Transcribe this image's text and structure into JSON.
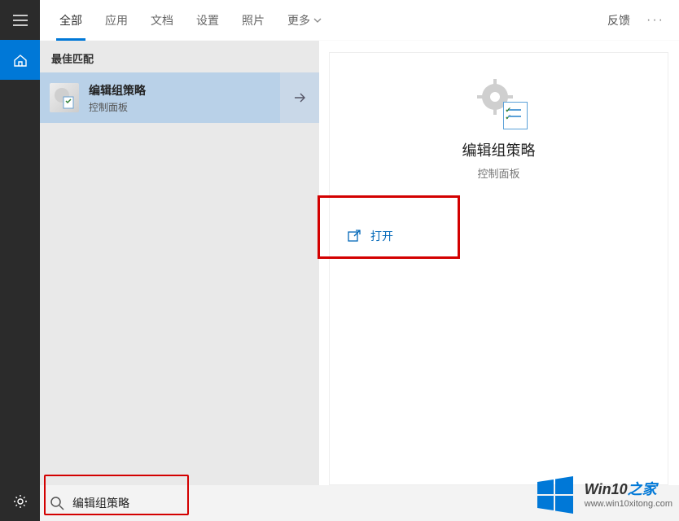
{
  "sidebar": {
    "items": [
      {
        "name": "menu"
      },
      {
        "name": "home"
      },
      {
        "name": "settings"
      }
    ]
  },
  "tabs": {
    "items": [
      {
        "label": "全部",
        "active": true
      },
      {
        "label": "应用"
      },
      {
        "label": "文档"
      },
      {
        "label": "设置"
      },
      {
        "label": "照片"
      }
    ],
    "more_label": "更多",
    "feedback_label": "反馈"
  },
  "results": {
    "section_title": "最佳匹配",
    "best": {
      "title": "编辑组策略",
      "subtitle": "控制面板"
    }
  },
  "preview": {
    "title": "编辑组策略",
    "subtitle": "控制面板",
    "open_label": "打开"
  },
  "search": {
    "value": "编辑组策略",
    "placeholder": ""
  },
  "watermark": {
    "brand_prefix": "Win10",
    "brand_suffix": "之家",
    "url": "www.win10xitong.com"
  },
  "colors": {
    "accent": "#0078d7",
    "highlight_bg": "#b9d1e8",
    "annotation": "#d30000"
  }
}
